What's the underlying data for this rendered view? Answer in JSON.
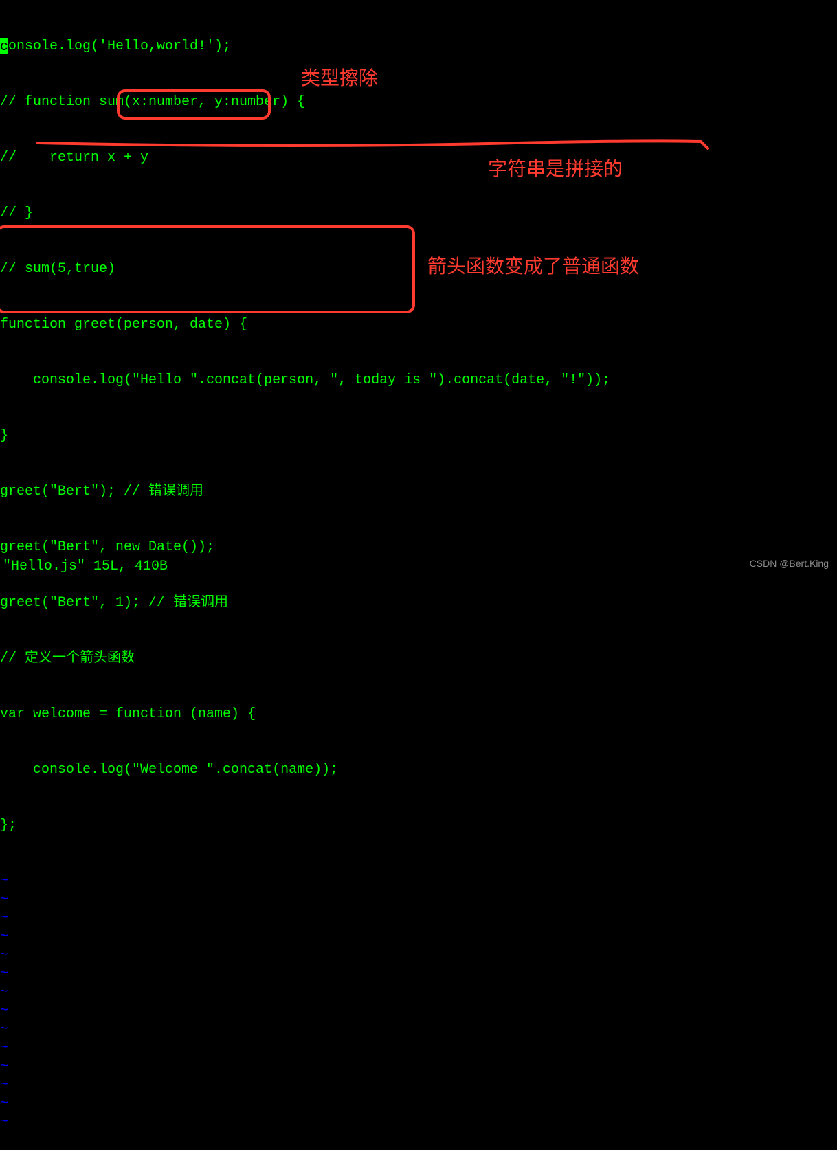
{
  "cursor_char": "c",
  "code_lines": [
    "onsole.log('Hello,world!');",
    "// function sum(x:number, y:number) {",
    "//    return x + y",
    "// }",
    "// sum(5,true)",
    "function greet(person, date) {",
    "    console.log(\"Hello \".concat(person, \", today is \").concat(date, \"!\"));",
    "}",
    "greet(\"Bert\"); // 错误调用",
    "greet(\"Bert\", new Date());",
    "greet(\"Bert\", 1); // 错误调用",
    "// 定义一个箭头函数",
    "var welcome = function (name) {",
    "    console.log(\"Welcome \".concat(name));",
    "};"
  ],
  "tilde": "~",
  "tilde_count": 14,
  "status_line": "\"Hello.js\" 15L, 410B",
  "annotations": {
    "type_erasure": "类型擦除",
    "string_concat": "字符串是拼接的",
    "arrow_function": "箭头函数变成了普通函数"
  },
  "watermark": "CSDN @Bert.King",
  "colors": {
    "background": "#000000",
    "text": "#00ff00",
    "tilde": "#0000ff",
    "annotation": "#ff3b30",
    "watermark": "#8a8a8a"
  }
}
